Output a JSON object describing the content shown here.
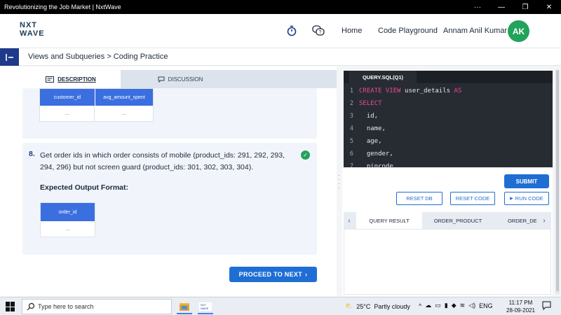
{
  "window": {
    "title": "Revolutionizing the Job Market | NxtWave",
    "controls": [
      "···",
      "—",
      "❐",
      "✕"
    ]
  },
  "nav": {
    "logo_line1": "NXT",
    "logo_line2": "WAVE",
    "home": "Home",
    "code_playground": "Code Playground",
    "user_name": "Annam Anil Kumar",
    "avatar_initials": "AK"
  },
  "breadcrumb": {
    "text": "Views and Subqueries > Coding Practice"
  },
  "tabs": {
    "description": "DESCRIPTION",
    "discussion": "DISCUSSION"
  },
  "prev_table": {
    "headers": [
      "customer_id",
      "avg_amount_spent"
    ],
    "cells": [
      "...",
      "..."
    ]
  },
  "question": {
    "number": "8.",
    "text": "Get order ids in which order consists of mobile (product_ids: 291, 292, 293, 294, 296) but not screen guard (product_ids: 301, 302, 303, 304).",
    "expected_label": "Expected Output Format:",
    "table_header": "order_id",
    "table_cell": "...",
    "status": "completed"
  },
  "proceed_button": "PROCEED TO NEXT",
  "editor": {
    "tab": "QUERY.SQL(Q1)",
    "lines": [
      {
        "n": "1",
        "parts": [
          {
            "t": "CREATE VIEW ",
            "kw": true
          },
          {
            "t": "user_details ",
            "kw": false
          },
          {
            "t": "AS",
            "kw": true
          }
        ]
      },
      {
        "n": "2",
        "parts": [
          {
            "t": "SELECT",
            "kw": true
          }
        ]
      },
      {
        "n": "3",
        "parts": [
          {
            "t": "  id,",
            "kw": false
          }
        ]
      },
      {
        "n": "4",
        "parts": [
          {
            "t": "  name,",
            "kw": false
          }
        ]
      },
      {
        "n": "5",
        "parts": [
          {
            "t": "  age,",
            "kw": false
          }
        ]
      },
      {
        "n": "6",
        "parts": [
          {
            "t": "  gender,",
            "kw": false
          }
        ]
      },
      {
        "n": "7",
        "parts": [
          {
            "t": "  pincode",
            "kw": false
          }
        ]
      }
    ]
  },
  "actions": {
    "submit": "SUBMIT",
    "reset_db": "RESET DB",
    "reset_code": "RESET CODE",
    "run_code": "RUN CODE"
  },
  "result_tabs": [
    "QUERY RESULT",
    "ORDER_PRODUCT",
    "ORDER_DE"
  ],
  "taskbar": {
    "search_placeholder": "Type here to search",
    "weather_temp": "25°C",
    "weather_text": "Partly cloudy",
    "lang": "ENG",
    "time": "11:17 PM",
    "date": "28-09-2021"
  },
  "colors": {
    "primary": "#1f6ed4",
    "accent_green": "#22a35b",
    "editor_bg": "#272c33",
    "keyword": "#ec4899"
  }
}
